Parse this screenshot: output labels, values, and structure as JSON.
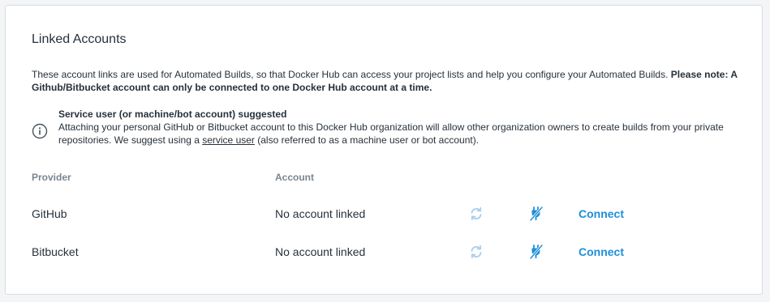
{
  "section": {
    "title": "Linked Accounts",
    "intro_text": "These account links are used for Automated Builds, so that Docker Hub can access your project lists and help you configure your Automated Builds. ",
    "intro_bold": "Please note: A Github/Bitbucket account can only be connected to one Docker Hub account at a time."
  },
  "notice": {
    "icon": "info-icon",
    "title": "Service user (or machine/bot account) suggested",
    "text_before": "Attaching your personal GitHub or Bitbucket account to this Docker Hub organization will allow other organization owners to create builds from your private repositories. We suggest using a ",
    "link_label": "service user",
    "text_after": " (also referred to as a machine user or bot account)."
  },
  "table": {
    "headers": {
      "provider": "Provider",
      "account": "Account"
    },
    "rows": [
      {
        "provider": "GitHub",
        "account": "No account linked",
        "action": "Connect"
      },
      {
        "provider": "Bitbucket",
        "account": "No account linked",
        "action": "Connect"
      }
    ]
  },
  "colors": {
    "accent": "#1d8fd9",
    "refresh_icon": "#a9cfee",
    "text": "#27313a",
    "muted": "#7a858f"
  }
}
